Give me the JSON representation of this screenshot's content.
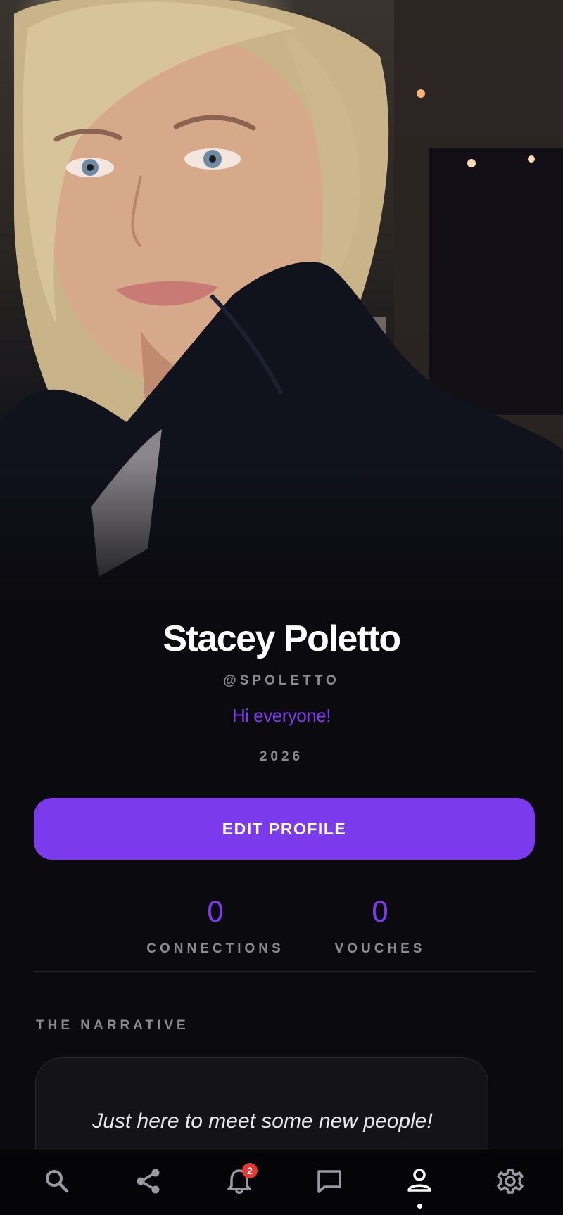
{
  "profile": {
    "name": "Stacey Poletto",
    "handle": "@SPOLETTO",
    "status": "Hi everyone!",
    "year": "2026",
    "edit_button_label": "EDIT PROFILE"
  },
  "stats": {
    "connections": {
      "value": "0",
      "label": "CONNECTIONS"
    },
    "vouches": {
      "value": "0",
      "label": "VOUCHES"
    }
  },
  "narrative": {
    "title": "THE NARRATIVE",
    "text": "Just here to meet some new people!"
  },
  "bottom_nav": {
    "items": [
      {
        "icon": "search-icon"
      },
      {
        "icon": "share-icon"
      },
      {
        "icon": "bell-icon",
        "badge": "2"
      },
      {
        "icon": "chat-icon"
      },
      {
        "icon": "profile-icon",
        "active": true
      },
      {
        "icon": "gear-icon"
      }
    ]
  },
  "colors": {
    "accent": "#7c3aed",
    "background": "#0b0a0e",
    "muted": "#8c8a93",
    "badge": "#e53935"
  }
}
